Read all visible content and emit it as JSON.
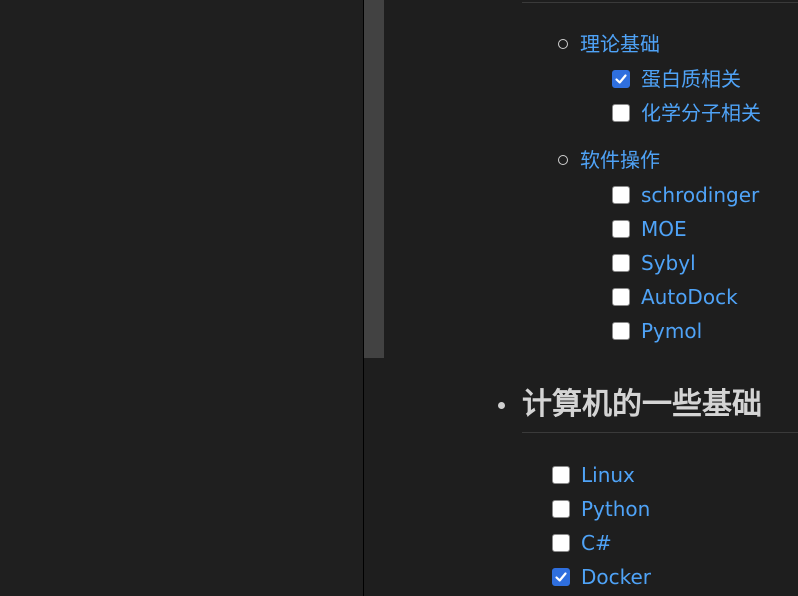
{
  "sections": [
    {
      "label": "理论基础",
      "items": [
        {
          "label": "蛋白质相关",
          "checked": true
        },
        {
          "label": "化学分子相关",
          "checked": false
        }
      ]
    },
    {
      "label": "软件操作",
      "items": [
        {
          "label": "schrodinger",
          "checked": false
        },
        {
          "label": "MOE",
          "checked": false
        },
        {
          "label": "Sybyl",
          "checked": false
        },
        {
          "label": "AutoDock",
          "checked": false
        },
        {
          "label": "Pymol",
          "checked": false
        }
      ]
    }
  ],
  "heading": "计算机的一些基础",
  "computer_items": [
    {
      "label": "Linux",
      "checked": false
    },
    {
      "label": "Python",
      "checked": false
    },
    {
      "label": "C#",
      "checked": false
    },
    {
      "label": "Docker",
      "checked": true
    }
  ],
  "colors": {
    "background": "#1e1e1e",
    "link": "#4fa3f7",
    "checkbox_checked": "#2f6fde",
    "scrollbar_thumb": "#424242"
  }
}
